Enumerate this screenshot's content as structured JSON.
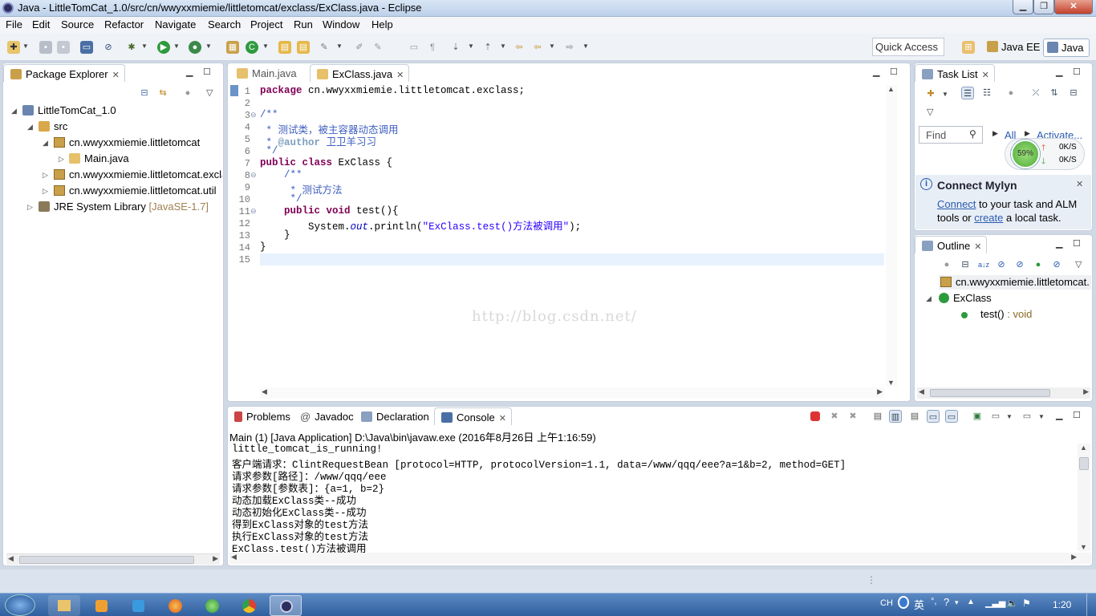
{
  "window": {
    "title": "Java - LittleTomCat_1.0/src/cn/wwyxxmiemie/littletomcat/exclass/ExClass.java - Eclipse"
  },
  "menu": [
    "File",
    "Edit",
    "Source",
    "Refactor",
    "Navigate",
    "Search",
    "Project",
    "Run",
    "Window",
    "Help"
  ],
  "toolbar": {
    "quick_access": "Quick Access",
    "perspectives": [
      "Java EE",
      "Java"
    ]
  },
  "package_explorer": {
    "title": "Package Explorer",
    "project": "LittleTomCat_1.0",
    "src": "src",
    "packages": [
      "cn.wwyxxmiemie.littletomcat",
      "cn.wwyxxmiemie.littletomcat.excla",
      "cn.wwyxxmiemie.littletomcat.util"
    ],
    "file": "Main.java",
    "jre": "JRE System Library",
    "jre_version": "[JavaSE-1.7]"
  },
  "editor": {
    "tabs": [
      "Main.java",
      "ExClass.java"
    ],
    "line_numbers": [
      "1",
      "2",
      "3",
      "4",
      "5",
      "6",
      "7",
      "8",
      "9",
      "10",
      "11",
      "12",
      "13",
      "14",
      "15"
    ],
    "code": {
      "l1_kw": "package",
      "l1_rest": " cn.wwyxxmiemie.littletomcat.exclass;",
      "l3": "/**",
      "l4": " * 测试类，被主容器动态调用",
      "l5_pre": " * ",
      "l5_tag": "@author",
      "l5_rest": " 卫卫羊习习",
      "l6": " */",
      "l7_kw": "public class",
      "l7_rest": " ExClass {",
      "l8": "    /**",
      "l9": "     * 测试方法",
      "l10": "     */",
      "l11_kw": "    public void",
      "l11_rest": " test(){",
      "l12_a": "        System.",
      "l12_out": "out",
      "l12_b": ".println(",
      "l12_str": "\"ExClass.test()方法被调用\"",
      "l12_c": ");",
      "l13": "    }",
      "l14": "}"
    },
    "watermark": "http://blog.csdn.net/"
  },
  "task_list": {
    "title": "Task List",
    "find_placeholder": "Find",
    "all": "All",
    "activate": "Activate...",
    "gauge": "59%",
    "up_rate": "0K/S",
    "down_rate": "0K/S"
  },
  "mylyn": {
    "title": "Connect Mylyn",
    "connect": "Connect",
    "text1": " to your task and ALM",
    "text2": "tools or ",
    "create": "create",
    "text3": " a local task."
  },
  "outline": {
    "title": "Outline",
    "package": "cn.wwyxxmiemie.littletomcat.",
    "class": "ExClass",
    "method": "test()",
    "method_type": " : void"
  },
  "console": {
    "tabs": [
      "Problems",
      "Javadoc",
      "Declaration",
      "Console"
    ],
    "header": "Main (1) [Java Application] D:\\Java\\bin\\javaw.exe (2016年8月26日 上午1:16:59)",
    "lines": [
      "little_tomcat_is_running!",
      "客户端请求：ClintRequestBean [protocol=HTTP, protocolVersion=1.1, data=/www/qqq/eee?a=1&b=2, method=GET]",
      "请求参数[路径]：/www/qqq/eee",
      "请求参数[参数表]：{a=1, b=2}",
      "动态加载ExClass类--成功",
      "动态初始化ExClass类--成功",
      "得到ExClass对象的test方法",
      "执行ExClass对象的test方法",
      "ExClass.test()方法被调用"
    ]
  },
  "systray": {
    "lang": "CH",
    "ime": "英",
    "clock": "1:20"
  },
  "colors": {
    "window_bg": "#cfd9e6",
    "keyword": "#7f0055",
    "javadoc": "#3f5fbf",
    "string": "#2a00ff",
    "taskbar": "#2f5f9e"
  }
}
